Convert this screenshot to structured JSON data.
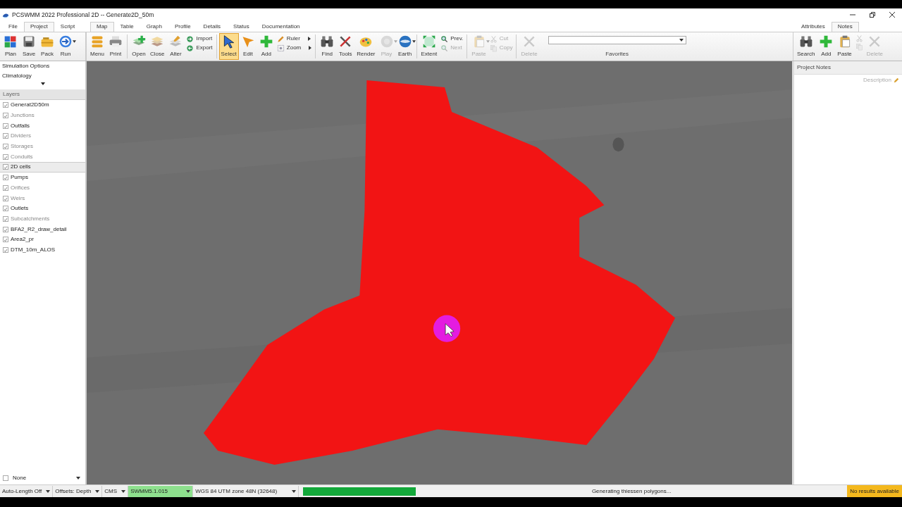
{
  "window": {
    "title": "PCSWMM 2022 Professional 2D -- Generate2D_50m"
  },
  "left_tabs": [
    {
      "label": "File",
      "selected": false
    },
    {
      "label": "Project",
      "selected": true
    },
    {
      "label": "Script",
      "selected": false
    }
  ],
  "main_tabs": [
    {
      "label": "Map",
      "selected": true
    },
    {
      "label": "Table",
      "selected": false
    },
    {
      "label": "Graph",
      "selected": false
    },
    {
      "label": "Profile",
      "selected": false
    },
    {
      "label": "Details",
      "selected": false
    },
    {
      "label": "Status",
      "selected": false
    },
    {
      "label": "Documentation",
      "selected": false
    }
  ],
  "right_tabs": [
    {
      "label": "Attributes",
      "selected": false
    },
    {
      "label": "Notes",
      "selected": true
    }
  ],
  "project_toolbar": [
    {
      "label": "Plan",
      "dropdown": false
    },
    {
      "label": "Save",
      "dropdown": false
    },
    {
      "label": "Pack",
      "dropdown": false
    },
    {
      "label": "Run",
      "dropdown": true
    }
  ],
  "map_toolbar": [
    [
      {
        "kind": "large",
        "label": "Menu",
        "disabled": false,
        "selected": false,
        "dropdown": false
      },
      {
        "kind": "large",
        "label": "Print",
        "disabled": false,
        "selected": false,
        "dropdown": false
      }
    ],
    [
      {
        "kind": "large",
        "label": "Open",
        "disabled": false,
        "selected": false,
        "dropdown": false
      },
      {
        "kind": "large",
        "label": "Close",
        "disabled": false,
        "selected": false,
        "dropdown": false
      },
      {
        "kind": "large",
        "label": "Alter",
        "disabled": false,
        "selected": false,
        "dropdown": false
      },
      {
        "kind": "small",
        "label": "Import",
        "disabled": false,
        "submenu": false
      },
      {
        "kind": "small",
        "label": "Export",
        "disabled": false,
        "submenu": false
      }
    ],
    [
      {
        "kind": "large",
        "label": "Select",
        "disabled": false,
        "selected": true,
        "dropdown": false
      },
      {
        "kind": "large",
        "label": "Edit",
        "disabled": false,
        "selected": false,
        "dropdown": false
      },
      {
        "kind": "large",
        "label": "Add",
        "disabled": false,
        "selected": false,
        "dropdown": false
      },
      {
        "kind": "small",
        "label": "Ruler",
        "disabled": false,
        "submenu": true
      },
      {
        "kind": "small",
        "label": "Zoom",
        "disabled": false,
        "submenu": true
      }
    ],
    [
      {
        "kind": "large",
        "label": "Find",
        "disabled": false,
        "selected": false,
        "dropdown": false
      },
      {
        "kind": "large",
        "label": "Tools",
        "disabled": false,
        "selected": false,
        "dropdown": false
      },
      {
        "kind": "large",
        "label": "Render",
        "disabled": false,
        "selected": false,
        "dropdown": false
      },
      {
        "kind": "large",
        "label": "Play",
        "disabled": true,
        "selected": false,
        "dropdown": true
      },
      {
        "kind": "large",
        "label": "Earth",
        "disabled": false,
        "selected": false,
        "dropdown": true
      }
    ],
    [
      {
        "kind": "large",
        "label": "Extent",
        "disabled": false,
        "selected": false,
        "dropdown": false
      },
      {
        "kind": "small",
        "label": "Prev.",
        "disabled": false,
        "submenu": false
      },
      {
        "kind": "small",
        "label": "Next",
        "disabled": true,
        "submenu": false
      }
    ],
    [
      {
        "kind": "large",
        "label": "Paste",
        "disabled": true,
        "selected": false,
        "dropdown": true
      },
      {
        "kind": "small",
        "label": "Cut",
        "disabled": true,
        "submenu": false
      },
      {
        "kind": "small",
        "label": "Copy",
        "disabled": true,
        "submenu": false
      }
    ],
    [
      {
        "kind": "large",
        "label": "Delete",
        "disabled": true,
        "selected": false,
        "dropdown": false
      }
    ]
  ],
  "favorites": {
    "label": "Favorites"
  },
  "notes_toolbar": [
    {
      "kind": "large",
      "label": "Search",
      "disabled": false
    },
    {
      "kind": "large",
      "label": "Add",
      "disabled": false
    },
    {
      "kind": "large",
      "label": "Paste",
      "disabled": false
    },
    {
      "kind": "tiny",
      "disabled": true
    },
    {
      "kind": "tiny",
      "disabled": true
    },
    {
      "kind": "large",
      "label": "Delete",
      "disabled": true
    }
  ],
  "sidebar": {
    "options": [
      "Simulation Options",
      "Climatology"
    ],
    "layers_header": "Layers",
    "layers": [
      {
        "label": "Generat2D50m",
        "checked": true,
        "dimmed": false,
        "selected": false
      },
      {
        "label": "Junctions",
        "checked": true,
        "dimmed": true,
        "selected": false
      },
      {
        "label": "Outfalls",
        "checked": true,
        "dimmed": false,
        "selected": false
      },
      {
        "label": "Dividers",
        "checked": true,
        "dimmed": true,
        "selected": false
      },
      {
        "label": "Storages",
        "checked": true,
        "dimmed": true,
        "selected": false
      },
      {
        "label": "Conduits",
        "checked": true,
        "dimmed": true,
        "selected": false
      },
      {
        "label": "2D cells",
        "checked": true,
        "dimmed": false,
        "selected": true
      },
      {
        "label": "Pumps",
        "checked": true,
        "dimmed": false,
        "selected": false
      },
      {
        "label": "Orifices",
        "checked": true,
        "dimmed": true,
        "selected": false
      },
      {
        "label": "Weirs",
        "checked": true,
        "dimmed": true,
        "selected": false
      },
      {
        "label": "Outlets",
        "checked": true,
        "dimmed": false,
        "selected": false
      },
      {
        "label": "Subcatchments",
        "checked": true,
        "dimmed": true,
        "selected": false
      },
      {
        "label": "BFA2_R2_draw_detail",
        "checked": true,
        "dimmed": false,
        "selected": false
      },
      {
        "label": "Area2_pr",
        "checked": true,
        "dimmed": false,
        "selected": false
      },
      {
        "label": "DTM_10m_ALOS",
        "checked": true,
        "dimmed": false,
        "selected": false
      }
    ],
    "backdrop": {
      "label": "None",
      "checked": false
    }
  },
  "map": {
    "kind": "picture"
  },
  "notes_panel": {
    "header": "Project Notes",
    "description": "Description"
  },
  "status_bar": {
    "dropdowns": [
      {
        "label": "Auto-Length Off",
        "highlight": false
      },
      {
        "label": "Offsets: Depth",
        "highlight": false
      },
      {
        "label": "CMS",
        "highlight": false
      },
      {
        "label": "SWMM5.1.015",
        "highlight": true
      },
      {
        "label": "WGS 84 UTM zone 48N (32648)",
        "highlight": false
      }
    ],
    "progress": {
      "level": 1.0
    },
    "message": "Generating thiessen polygons...",
    "results": "No results available"
  }
}
